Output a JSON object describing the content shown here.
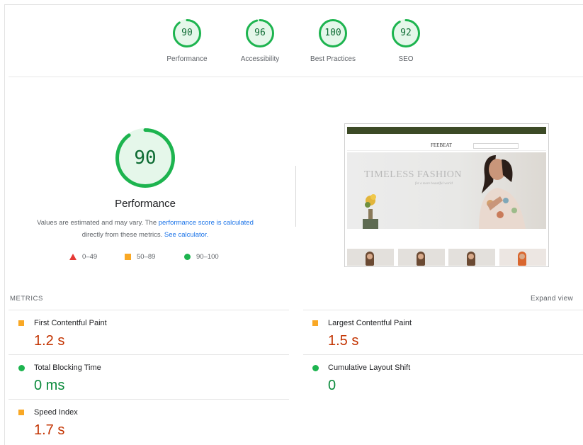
{
  "gauges": [
    {
      "score": "90",
      "label": "Performance",
      "fraction": 0.9
    },
    {
      "score": "96",
      "label": "Accessibility",
      "fraction": 0.96
    },
    {
      "score": "100",
      "label": "Best Practices",
      "fraction": 1.0
    },
    {
      "score": "92",
      "label": "SEO",
      "fraction": 0.92
    }
  ],
  "main": {
    "score": "90",
    "fraction": 0.9,
    "title": "Performance",
    "desc_prefix": "Values are estimated and may vary. The ",
    "desc_link1": "performance score is calculated",
    "desc_middle": " directly from these metrics. ",
    "desc_link2": "See calculator.",
    "legend": [
      {
        "shape": "triangle",
        "range": "0–49"
      },
      {
        "shape": "square",
        "range": "50–89"
      },
      {
        "shape": "circle",
        "range": "90–100"
      }
    ]
  },
  "thumbnail": {
    "hero_title": "TIMELESS FASHION",
    "hero_subtitle": "for a more beautiful world",
    "brand": "FEEBEAT"
  },
  "metrics": {
    "header": "METRICS",
    "expand_label": "Expand view",
    "items": [
      {
        "name": "First Contentful Paint",
        "value": "1.2 s",
        "status": "average"
      },
      {
        "name": "Largest Contentful Paint",
        "value": "1.5 s",
        "status": "average"
      },
      {
        "name": "Total Blocking Time",
        "value": "0 ms",
        "status": "pass"
      },
      {
        "name": "Cumulative Layout Shift",
        "value": "0",
        "status": "pass"
      },
      {
        "name": "Speed Index",
        "value": "1.7 s",
        "status": "average"
      }
    ]
  },
  "colors": {
    "pass": "#1db44f",
    "pass_fill": "#e5f7ea",
    "average": "#f9a825",
    "fail": "#e53935",
    "value_average": "#c33300",
    "value_pass": "#0a8a3b",
    "link": "#1a73e8"
  }
}
